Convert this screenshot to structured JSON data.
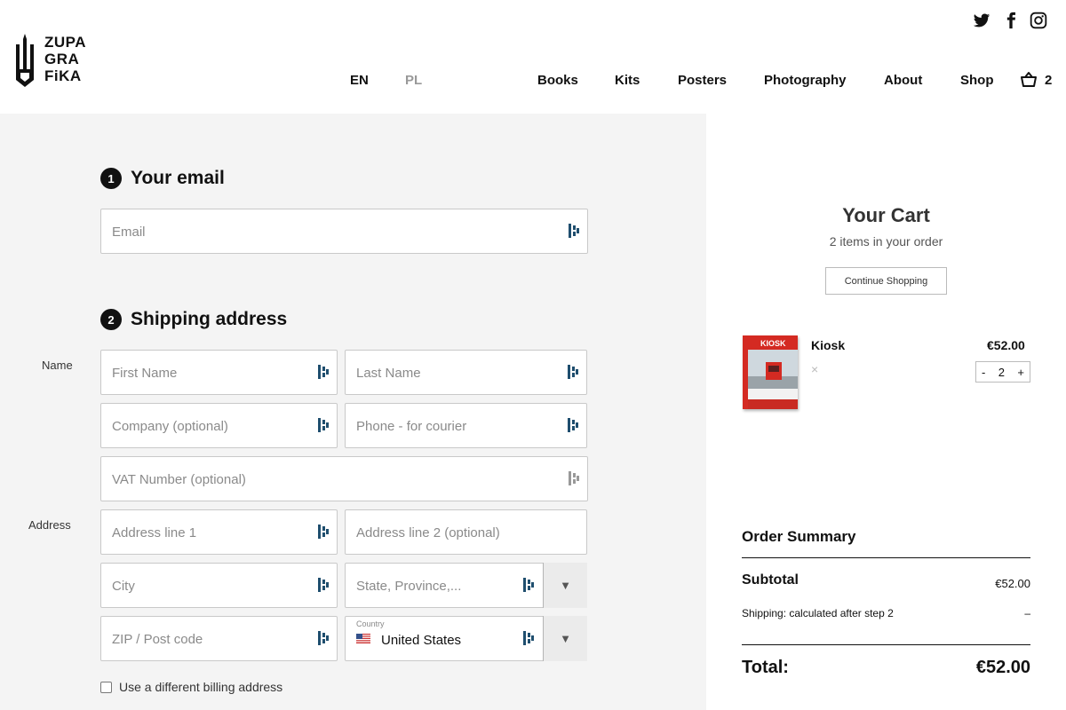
{
  "brand": {
    "line1": "ZUPA",
    "line2": "GRA",
    "line3": "FiKA"
  },
  "languages": {
    "en": "EN",
    "pl": "PL"
  },
  "nav": [
    "Books",
    "Kits",
    "Posters",
    "Photography",
    "About",
    "Shop"
  ],
  "social_icons": [
    "twitter-icon",
    "facebook-icon",
    "instagram-icon"
  ],
  "cart_badge": "2",
  "steps": {
    "email": {
      "number": "1",
      "title": "Your email"
    },
    "shipping": {
      "number": "2",
      "title": "Shipping address"
    }
  },
  "labels": {
    "name": "Name",
    "address": "Address"
  },
  "fields": {
    "email": "Email",
    "first_name": "First Name",
    "last_name": "Last Name",
    "company": "Company (optional)",
    "phone": "Phone - for courier",
    "vat": "VAT Number (optional)",
    "address1": "Address line 1",
    "address2": "Address line 2 (optional)",
    "city": "City",
    "state": "State, Province,...",
    "zip": "ZIP / Post code",
    "country_label": "Country",
    "country_value": "United States"
  },
  "billing_checkbox": "Use a different billing address",
  "cart": {
    "title": "Your Cart",
    "subtitle": "2 items in your order",
    "continue_label": "Continue Shopping",
    "item": {
      "name": "Kiosk",
      "price": "€52.00",
      "quantity": "2",
      "remove": "×",
      "cover_text": "KIOSK",
      "minus": "-",
      "plus": "+"
    }
  },
  "summary": {
    "title": "Order Summary",
    "subtotal_label": "Subtotal",
    "subtotal_value": "€52.00",
    "shipping_label": "Shipping: calculated after step 2",
    "shipping_value": "–",
    "total_label": "Total:",
    "total_value": "€52.00"
  },
  "colors": {
    "form_bg": "#f4f4f4",
    "cover_red": "#d42a22",
    "keeper_icon": "#1f4e6e"
  }
}
